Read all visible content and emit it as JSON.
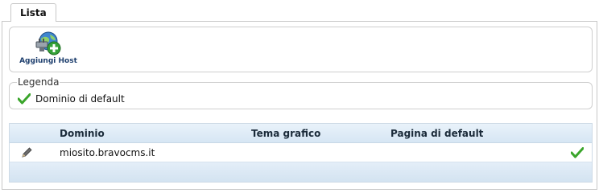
{
  "tabs": [
    {
      "label": "Lista",
      "active": true
    }
  ],
  "toolbar": {
    "add_host": {
      "label": "Aggiungi Host",
      "icon": "globe-plug-add-icon"
    }
  },
  "legend": {
    "title": "Legenda",
    "items": [
      {
        "icon": "green-check-icon",
        "label": "Dominio di default"
      }
    ]
  },
  "grid": {
    "columns": [
      "Dominio",
      "Tema grafico",
      "Pagina di default"
    ],
    "rows": [
      {
        "edit_icon": "pencil-icon",
        "dominio": "miosito.bravocms.it",
        "tema_grafico": "",
        "pagina_default": "",
        "is_default": true
      }
    ]
  },
  "colors": {
    "accent_green": "#3aa52b",
    "header_blue": "#d6e6f4",
    "label_blue": "#1e3f6e"
  }
}
